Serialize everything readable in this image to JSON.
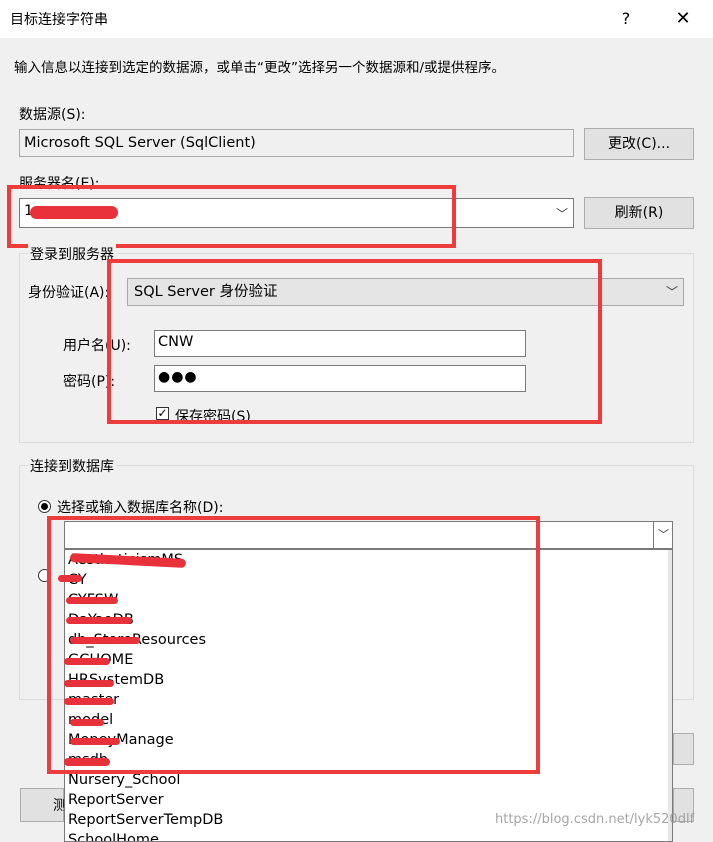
{
  "window": {
    "title": "目标连接字符串",
    "help": "?",
    "close": "✕"
  },
  "description": "输入信息以连接到选定的数据源，或单击“更改”选择另一个数据源和/或提供程序。",
  "datasource": {
    "label": "数据源(S):",
    "value": "Microsoft SQL Server (SqlClient)",
    "change_button": "更改(C)..."
  },
  "server": {
    "label": "服务器名(E):",
    "value": "1",
    "refresh_button": "刷新(R)"
  },
  "login": {
    "group_title": "登录到服务器",
    "auth_label": "身份验证(A):",
    "auth_value": "SQL Server 身份验证",
    "username_label": "用户名(U):",
    "username_value": "CNW",
    "password_label": "密码(P):",
    "password_value": "●●●",
    "save_password_label": "保存密码(S)",
    "save_password_checked": true
  },
  "database": {
    "group_title": "连接到数据库",
    "select_label": "选择或输入数据库名称(D):",
    "select_value": "",
    "items": [
      "AestheticismMS",
      "CY",
      "CYFSW",
      "DaYaoDB",
      "db_StoreResources",
      "GCHOME",
      "HRSystemDB",
      "master",
      "model",
      "MoneyManage",
      "msdb",
      "Nursery_School",
      "ReportServer",
      "ReportServerTempDB",
      "SchoolHome"
    ]
  },
  "watermark": "https://blog.csdn.net/lyk520dlf",
  "annotation_color": "#ee3b3b"
}
